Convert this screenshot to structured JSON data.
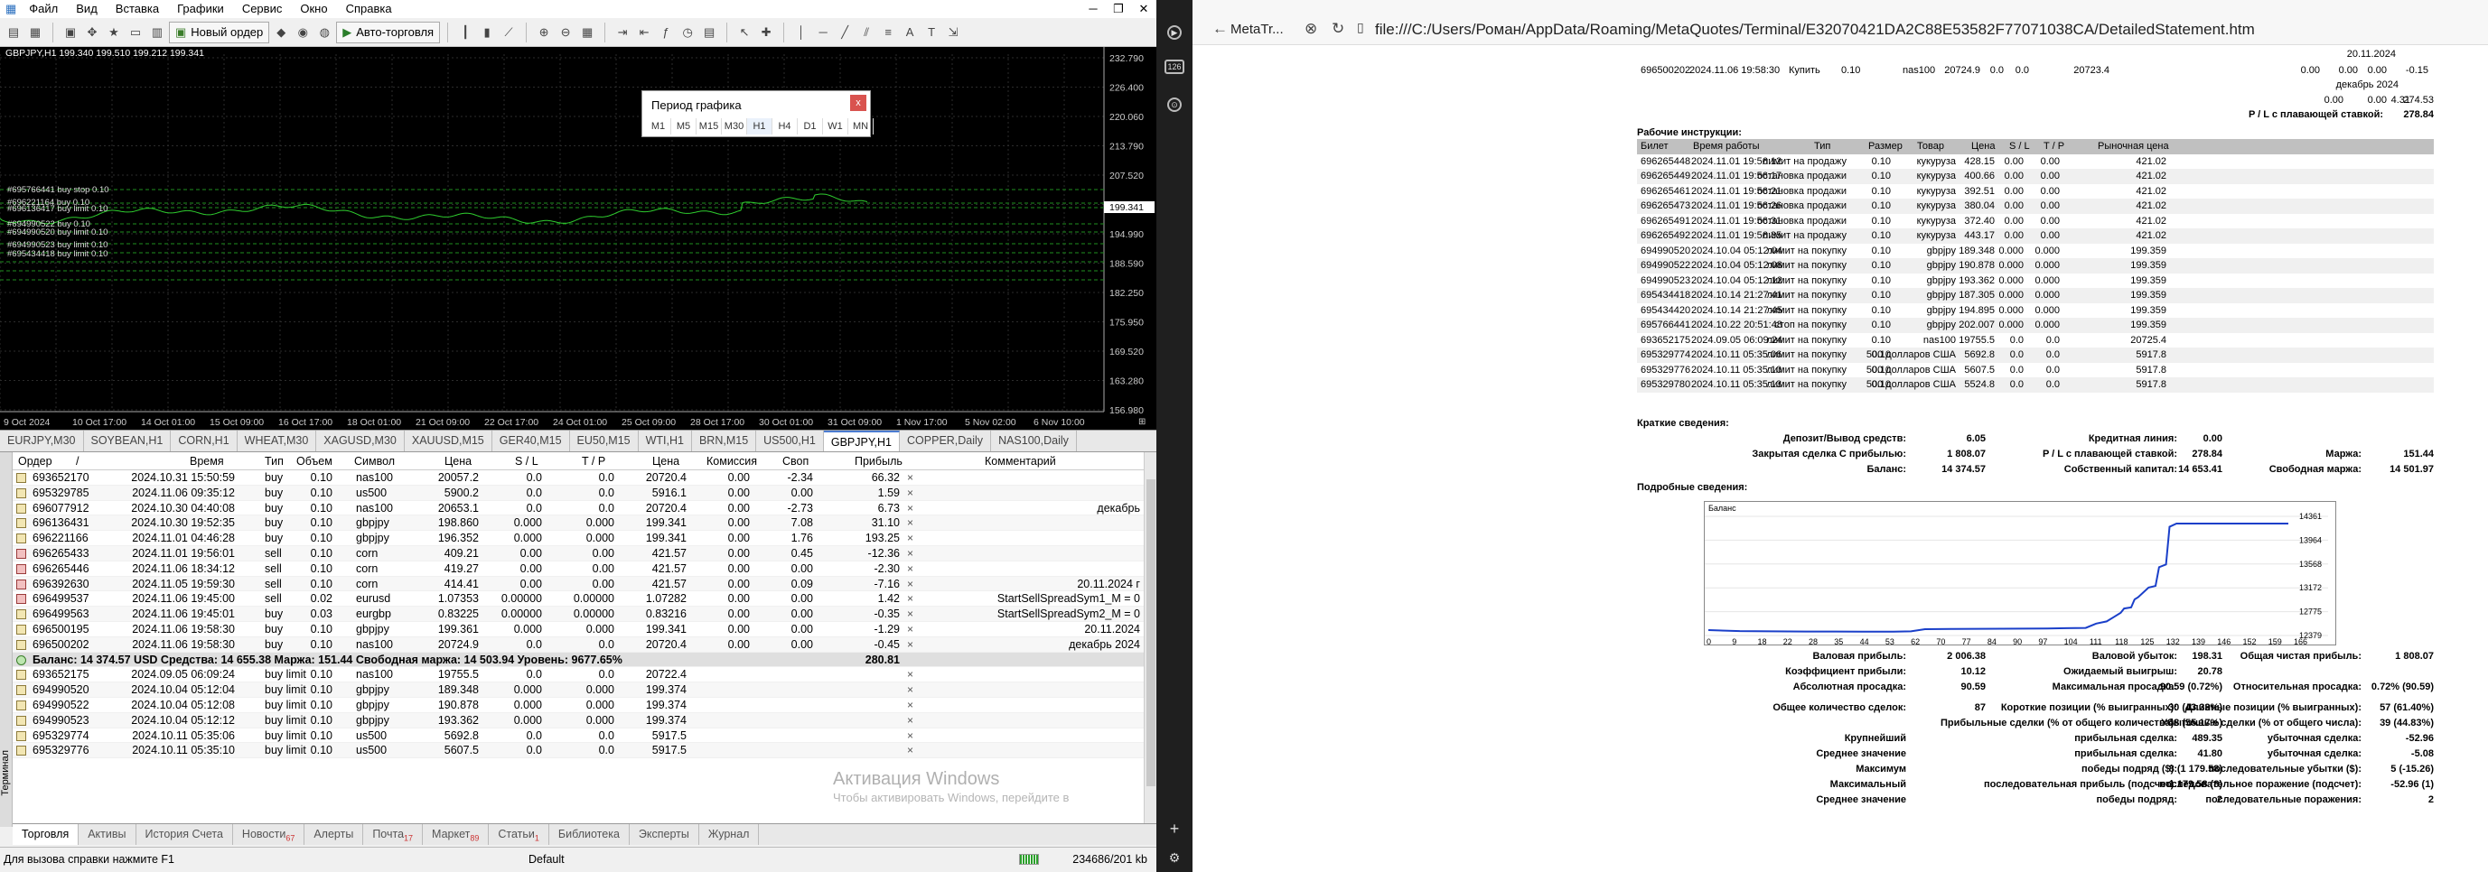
{
  "menu": [
    "Файл",
    "Вид",
    "Вставка",
    "Графики",
    "Сервис",
    "Окно",
    "Справка"
  ],
  "toolbar": {
    "new_order": "Новый ордер",
    "auto_trading": "Авто-торговля"
  },
  "chart": {
    "symbol_info": "GBPJPY,H1  199.340 199.510 199.212 199.341",
    "price_labels": [
      "232.790",
      "226.400",
      "220.060",
      "213.790",
      "207.520",
      "201.250",
      "194.990",
      "188.590",
      "182.250",
      "175.950",
      "169.520",
      "163.280",
      "156.980"
    ],
    "current_price": "199.341",
    "time_labels": [
      "9 Oct 2024",
      "10 Oct 17:00",
      "14 Oct 01:00",
      "15 Oct 09:00",
      "16 Oct 17:00",
      "18 Oct 01:00",
      "21 Oct 09:00",
      "22 Oct 17:00",
      "24 Oct 01:00",
      "25 Oct 09:00",
      "28 Oct 17:00",
      "30 Oct 01:00",
      "31 Oct 09:00",
      "1 Nov 17:00",
      "5 Nov 02:00",
      "6 Nov 10:00"
    ],
    "order_labels": [
      "#695766441 buy stop 0.10",
      "#696221164 buy 0.10",
      "#696136417 buy limit 0.10",
      "#694990522 buy 0.10",
      "#694990520 buy limit 0.10",
      "#694990523 buy limit 0.10",
      "#695434418 buy limit 0.10"
    ]
  },
  "period_dialog": {
    "title": "Период графика",
    "close": "x",
    "periods": [
      "M1",
      "M5",
      "M15",
      "M30",
      "H1",
      "H4",
      "D1",
      "W1",
      "MN"
    ],
    "selected": "H1"
  },
  "symbol_tabs": [
    "EURJPY,M30",
    "SOYBEAN,H1",
    "CORN,H1",
    "WHEAT,M30",
    "XAGUSD,M30",
    "XAUUSD,M15",
    "GER40,M15",
    "EU50,M15",
    "WTI,H1",
    "BRN,M15",
    "US500,H1",
    "GBPJPY,H1",
    "COPPER,Daily",
    "NAS100,Daily"
  ],
  "symbol_tabs_active": "GBPJPY,H1",
  "terminal": {
    "side_label": "Терминал",
    "headers": {
      "order": "Ордер",
      "sort": "/",
      "time": "Время",
      "type": "Тип",
      "volume": "Объем",
      "symbol": "Символ",
      "price": "Цена",
      "sl": "S / L",
      "tp": "T / P",
      "cur_price": "Цена",
      "commission": "Комиссия",
      "swap": "Своп",
      "profit": "Прибыль",
      "comment": "Комментарий"
    },
    "positions": [
      {
        "order": "693652170",
        "time": "2024.10.31 15:50:59",
        "type": "buy",
        "volume": "0.10",
        "symbol": "nas100",
        "price": "20057.2",
        "sl": "0.0",
        "tp": "0.0",
        "cur": "20720.4",
        "commission": "0.00",
        "swap": "-2.34",
        "profit": "66.32",
        "comment": ""
      },
      {
        "order": "695329785",
        "time": "2024.11.06 09:35:12",
        "type": "buy",
        "volume": "0.10",
        "symbol": "us500",
        "price": "5900.2",
        "sl": "0.0",
        "tp": "0.0",
        "cur": "5916.1",
        "commission": "0.00",
        "swap": "0.00",
        "profit": "1.59",
        "comment": ""
      },
      {
        "order": "696077912",
        "time": "2024.10.30 04:40:08",
        "type": "buy",
        "volume": "0.10",
        "symbol": "nas100",
        "price": "20653.1",
        "sl": "0.0",
        "tp": "0.0",
        "cur": "20720.4",
        "commission": "0.00",
        "swap": "-2.73",
        "profit": "6.73",
        "comment": "декабрь"
      },
      {
        "order": "696136431",
        "time": "2024.10.30 19:52:35",
        "type": "buy",
        "volume": "0.10",
        "symbol": "gbpjpy",
        "price": "198.860",
        "sl": "0.000",
        "tp": "0.000",
        "cur": "199.341",
        "commission": "0.00",
        "swap": "7.08",
        "profit": "31.10",
        "comment": ""
      },
      {
        "order": "696221166",
        "time": "2024.11.01 04:46:28",
        "type": "buy",
        "volume": "0.10",
        "symbol": "gbpjpy",
        "price": "196.352",
        "sl": "0.000",
        "tp": "0.000",
        "cur": "199.341",
        "commission": "0.00",
        "swap": "1.76",
        "profit": "193.25",
        "comment": ""
      },
      {
        "order": "696265433",
        "time": "2024.11.01 19:56:01",
        "type": "sell",
        "volume": "0.10",
        "symbol": "corn",
        "price": "409.21",
        "sl": "0.00",
        "tp": "0.00",
        "cur": "421.57",
        "commission": "0.00",
        "swap": "0.45",
        "profit": "-12.36",
        "comment": ""
      },
      {
        "order": "696265446",
        "time": "2024.11.06 18:34:12",
        "type": "sell",
        "volume": "0.10",
        "symbol": "corn",
        "price": "419.27",
        "sl": "0.00",
        "tp": "0.00",
        "cur": "421.57",
        "commission": "0.00",
        "swap": "0.00",
        "profit": "-2.30",
        "comment": ""
      },
      {
        "order": "696392630",
        "time": "2024.11.05 19:59:30",
        "type": "sell",
        "volume": "0.10",
        "symbol": "corn",
        "price": "414.41",
        "sl": "0.00",
        "tp": "0.00",
        "cur": "421.57",
        "commission": "0.00",
        "swap": "0.09",
        "profit": "-7.16",
        "comment": "20.11.2024 г"
      },
      {
        "order": "696499537",
        "time": "2024.11.06 19:45:00",
        "type": "sell",
        "volume": "0.02",
        "symbol": "eurusd",
        "price": "1.07353",
        "sl": "0.00000",
        "tp": "0.00000",
        "cur": "1.07282",
        "commission": "0.00",
        "swap": "0.00",
        "profit": "1.42",
        "comment": "StartSellSpreadSym1_M = 0"
      },
      {
        "order": "696499563",
        "time": "2024.11.06 19:45:01",
        "type": "buy",
        "volume": "0.03",
        "symbol": "eurgbp",
        "price": "0.83225",
        "sl": "0.00000",
        "tp": "0.00000",
        "cur": "0.83216",
        "commission": "0.00",
        "swap": "0.00",
        "profit": "-0.35",
        "comment": "StartSellSpreadSym2_M = 0"
      },
      {
        "order": "696500195",
        "time": "2024.11.06 19:58:30",
        "type": "buy",
        "volume": "0.10",
        "symbol": "gbpjpy",
        "price": "199.361",
        "sl": "0.000",
        "tp": "0.000",
        "cur": "199.341",
        "commission": "0.00",
        "swap": "0.00",
        "profit": "-1.29",
        "comment": "20.11.2024"
      },
      {
        "order": "696500202",
        "time": "2024.11.06 19:58:30",
        "type": "buy",
        "volume": "0.10",
        "symbol": "nas100",
        "price": "20724.9",
        "sl": "0.0",
        "tp": "0.0",
        "cur": "20720.4",
        "commission": "0.00",
        "swap": "0.00",
        "profit": "-0.45",
        "comment": "декабрь 2024"
      }
    ],
    "summary": {
      "text": "Баланс: 14 374.57 USD  Средства: 14 655.38  Маржа: 151.44  Свободная маржа: 14 503.94  Уровень: 9677.65%",
      "profit": "280.81"
    },
    "pending": [
      {
        "order": "693652175",
        "time": "2024.09.05 06:09:24",
        "type": "buy limit",
        "volume": "0.10",
        "symbol": "nas100",
        "price": "19755.5",
        "sl": "0.0",
        "tp": "0.0",
        "cur": "20722.4"
      },
      {
        "order": "694990520",
        "time": "2024.10.04 05:12:04",
        "type": "buy limit",
        "volume": "0.10",
        "symbol": "gbpjpy",
        "price": "189.348",
        "sl": "0.000",
        "tp": "0.000",
        "cur": "199.374"
      },
      {
        "order": "694990522",
        "time": "2024.10.04 05:12:08",
        "type": "buy limit",
        "volume": "0.10",
        "symbol": "gbpjpy",
        "price": "190.878",
        "sl": "0.000",
        "tp": "0.000",
        "cur": "199.374"
      },
      {
        "order": "694990523",
        "time": "2024.10.04 05:12:12",
        "type": "buy limit",
        "volume": "0.10",
        "symbol": "gbpjpy",
        "price": "193.362",
        "sl": "0.000",
        "tp": "0.000",
        "cur": "199.374"
      },
      {
        "order": "695329774",
        "time": "2024.10.11 05:35:06",
        "type": "buy limit",
        "volume": "0.10",
        "symbol": "us500",
        "price": "5692.8",
        "sl": "0.0",
        "tp": "0.0",
        "cur": "5917.5"
      },
      {
        "order": "695329776",
        "time": "2024.10.11 05:35:10",
        "type": "buy limit",
        "volume": "0.10",
        "symbol": "us500",
        "price": "5607.5",
        "sl": "0.0",
        "tp": "0.0",
        "cur": "5917.5"
      }
    ],
    "close_glyph": "×"
  },
  "bottom_tabs": [
    {
      "label": "Торговля",
      "badge": ""
    },
    {
      "label": "Активы",
      "badge": ""
    },
    {
      "label": "История Счета",
      "badge": ""
    },
    {
      "label": "Новости",
      "badge": "67"
    },
    {
      "label": "Алерты",
      "badge": ""
    },
    {
      "label": "Почта",
      "badge": "17"
    },
    {
      "label": "Маркет",
      "badge": "89"
    },
    {
      "label": "Статьи",
      "badge": "1"
    },
    {
      "label": "Библиотека",
      "badge": ""
    },
    {
      "label": "Эксперты",
      "badge": ""
    },
    {
      "label": "Журнал",
      "badge": ""
    }
  ],
  "watermark": {
    "line1": "Активация Windows",
    "line2": "Чтобы активировать Windows, перейдите в"
  },
  "status": {
    "help": "Для вызова справки нажмите F1",
    "profile": "Default",
    "traffic": "234686/201 kb"
  },
  "sidebar_icons": [
    "▶",
    "126",
    "⊙"
  ],
  "browser": {
    "tab_title": "MetaTr...",
    "url": "file:///C:/Users/Роман/AppData/Roaming/MetaQuotes/Terminal/E32070421DA2C88E53582F77071038CA/DetailedStatement.htm"
  },
  "statement": {
    "top_row": {
      "ticket": "696500202",
      "time": "2024.11.06 19:58:30",
      "type": "Купить",
      "size": "0.10",
      "item": "nas100",
      "price": "20724.9",
      "sl": "0.0",
      "tp": "0.0",
      "cur": "20723.4",
      "c1": "0.00",
      "c2": "0.00",
      "c3": "0.00",
      "c4": "-0.15"
    },
    "top_right_note": "20.11.2024",
    "note2": "декабрь 2024",
    "totals_row": [
      "0.00",
      "0.00",
      "4.31",
      "274.53"
    ],
    "floating_label": "P / L с плавающей ставкой:",
    "floating_value": "278.84",
    "working_title": "Рабочие инструкции:",
    "working_headers": {
      "ticket": "Билет",
      "time": "Время работы",
      "type": "Тип",
      "size": "Размер",
      "item": "Товар",
      "price": "Цена",
      "sl": "S / L",
      "tp": "T / P",
      "market": "Рыночная цена"
    },
    "working_rows": [
      {
        "ticket": "696265448",
        "time": "2024.11.01 19:56:12",
        "type": "лимит на продажу",
        "size": "0.10",
        "item": "кукуруза",
        "price": "428.15",
        "sl": "0.00",
        "tp": "0.00",
        "market": "421.02"
      },
      {
        "ticket": "696265449",
        "time": "2024.11.01 19:56:17",
        "type": "остановка продажи",
        "size": "0.10",
        "item": "кукуруза",
        "price": "400.66",
        "sl": "0.00",
        "tp": "0.00",
        "market": "421.02"
      },
      {
        "ticket": "696265461",
        "time": "2024.11.01 19:56:21",
        "type": "остановка продажи",
        "size": "0.10",
        "item": "кукуруза",
        "price": "392.51",
        "sl": "0.00",
        "tp": "0.00",
        "market": "421.02"
      },
      {
        "ticket": "696265473",
        "time": "2024.11.01 19:56:26",
        "type": "остановка продажи",
        "size": "0.10",
        "item": "кукуруза",
        "price": "380.04",
        "sl": "0.00",
        "tp": "0.00",
        "market": "421.02"
      },
      {
        "ticket": "696265491",
        "time": "2024.11.01 19:56:31",
        "type": "остановка продажи",
        "size": "0.10",
        "item": "кукуруза",
        "price": "372.40",
        "sl": "0.00",
        "tp": "0.00",
        "market": "421.02"
      },
      {
        "ticket": "696265492",
        "time": "2024.11.01 19:56:35",
        "type": "лимит на продажу",
        "size": "0.10",
        "item": "кукуруза",
        "price": "443.17",
        "sl": "0.00",
        "tp": "0.00",
        "market": "421.02"
      },
      {
        "ticket": "694990520",
        "time": "2024.10.04 05:12:04",
        "type": "лимит на покупку",
        "size": "0.10",
        "item": "gbpjpy",
        "price": "189.348",
        "sl": "0.000",
        "tp": "0.000",
        "market": "199.359"
      },
      {
        "ticket": "694990522",
        "time": "2024.10.04 05:12:08",
        "type": "лимит на покупку",
        "size": "0.10",
        "item": "gbpjpy",
        "price": "190.878",
        "sl": "0.000",
        "tp": "0.000",
        "market": "199.359"
      },
      {
        "ticket": "694990523",
        "time": "2024.10.04 05:12:12",
        "type": "лимит на покупку",
        "size": "0.10",
        "item": "gbpjpy",
        "price": "193.362",
        "sl": "0.000",
        "tp": "0.000",
        "market": "199.359"
      },
      {
        "ticket": "695434418",
        "time": "2024.10.14 21:27:41",
        "type": "лимит на покупку",
        "size": "0.10",
        "item": "gbpjpy",
        "price": "187.305",
        "sl": "0.000",
        "tp": "0.000",
        "market": "199.359"
      },
      {
        "ticket": "695434420",
        "time": "2024.10.14 21:27:45",
        "type": "лимит на покупку",
        "size": "0.10",
        "item": "gbpjpy",
        "price": "194.895",
        "sl": "0.000",
        "tp": "0.000",
        "market": "199.359"
      },
      {
        "ticket": "695766441",
        "time": "2024.10.22 20:51:48",
        "type": "стоп на покупку",
        "size": "0.10",
        "item": "gbpjpy",
        "price": "202.007",
        "sl": "0.000",
        "tp": "0.000",
        "market": "199.359"
      },
      {
        "ticket": "693652175",
        "time": "2024.09.05 06:09:24",
        "type": "лимит на покупку",
        "size": "0.10",
        "item": "nas100",
        "price": "19755.5",
        "sl": "0.0",
        "tp": "0.0",
        "market": "20725.4"
      },
      {
        "ticket": "695329774",
        "time": "2024.10.11 05:35:06",
        "type": "лимит на покупку",
        "size": "0.10",
        "item": "500 долларов США",
        "price": "5692.8",
        "sl": "0.0",
        "tp": "0.0",
        "market": "5917.8"
      },
      {
        "ticket": "695329776",
        "time": "2024.10.11 05:35:10",
        "type": "лимит на покупку",
        "size": "0.10",
        "item": "500 долларов США",
        "price": "5607.5",
        "sl": "0.0",
        "tp": "0.0",
        "market": "5917.8"
      },
      {
        "ticket": "695329780",
        "time": "2024.10.11 05:35:13",
        "type": "лимит на покупку",
        "size": "0.10",
        "item": "500 долларов США",
        "price": "5524.8",
        "sl": "0.0",
        "tp": "0.0",
        "market": "5917.8"
      }
    ],
    "brief_title": "Краткие сведения:",
    "brief": {
      "deposit_label": "Депозит/Вывод средств:",
      "deposit": "6.05",
      "credit_label": "Кредитная линия:",
      "credit": "0.00",
      "closed_label": "Закрытая сделка С прибылью:",
      "closed": "1 808.07",
      "float_label": "P / L с плавающей ставкой:",
      "float": "278.84",
      "margin_label": "Маржа:",
      "margin": "151.44",
      "balance_label": "Баланс:",
      "balance": "14 374.57",
      "equity_label": "Собственный капитал:",
      "equity": "14 653.41",
      "free_label": "Свободная маржа:",
      "free": "14 501.97"
    },
    "detail_title": "Подробные сведения:",
    "balance_chart": {
      "title": "Баланс",
      "y_ticks": [
        "14361",
        "13964",
        "13568",
        "13172",
        "12775",
        "12379"
      ],
      "x_ticks": [
        "0",
        "9",
        "18",
        "22",
        "28",
        "35",
        "44",
        "53",
        "62",
        "70",
        "77",
        "84",
        "90",
        "97",
        "104",
        "111",
        "118",
        "125",
        "132",
        "139",
        "146",
        "152",
        "159",
        "166"
      ]
    },
    "details": {
      "gross_profit_label": "Валовая прибыль:",
      "gross_profit": "2 006.38",
      "gross_loss_label": "Валовой убыток:",
      "gross_loss": "198.31",
      "net_profit_label": "Общая чистая прибыль:",
      "net_profit": "1 808.07",
      "pf_label": "Коэффициент прибыли:",
      "pf": "10.12",
      "exp_label": "Ожидаемый выигрыш:",
      "exp": "20.78",
      "abs_dd_label": "Абсолютная просадка:",
      "abs_dd": "90.59",
      "max_dd_label": "Максимальная просадка:",
      "max_dd": "90.59 (0.72%)",
      "rel_dd_label": "Относительная просадка:",
      "rel_dd": "0.72% (90.59)",
      "total_label": "Общее количество сделок:",
      "total": "87",
      "short_label": "Короткие позиции (% выигранных):",
      "short": "30 (43.33%)",
      "long_label": "Длинные позиции (% выигранных):",
      "long": "57 (61.40%)",
      "profit_trades_label": "Прибыльные сделки (% от общего количества):",
      "profit_trades": "48 (55.17%)",
      "loss_trades_label": "Убыточные сделки (% от общего числа):",
      "loss_trades": "39 (44.83%)",
      "largest_label": "Крупнейший",
      "largest_p_label": "прибыльная сделка:",
      "largest_p": "489.35",
      "largest_l_label": "убыточная сделка:",
      "largest_l": "-52.96",
      "avg_label": "Среднее значение",
      "avg_p_label": "прибыльная сделка:",
      "avg_p": "41.80",
      "avg_l_label": "убыточная сделка:",
      "avg_l": "-5.08",
      "max_label": "Максимум",
      "max_w_label": "победы подряд ($):",
      "max_w": "8 (1 179.58)",
      "max_ls_label": "последовательные убытки ($):",
      "max_ls": "5 (-15.26)",
      "maximal_label": "Максимальный",
      "maximal_w_label": "последовательная прибыль (подсчет):",
      "maximal_w": "1 179.58 (8)",
      "maximal_l_label": "последовательное поражение (подсчет):",
      "maximal_l": "-52.96 (1)",
      "avg2_label": "Среднее значение",
      "avg2_w_label": "победы подряд:",
      "avg2_w": "2",
      "avg2_l_label": "последовательные поражения:",
      "avg2_l": "2"
    }
  }
}
